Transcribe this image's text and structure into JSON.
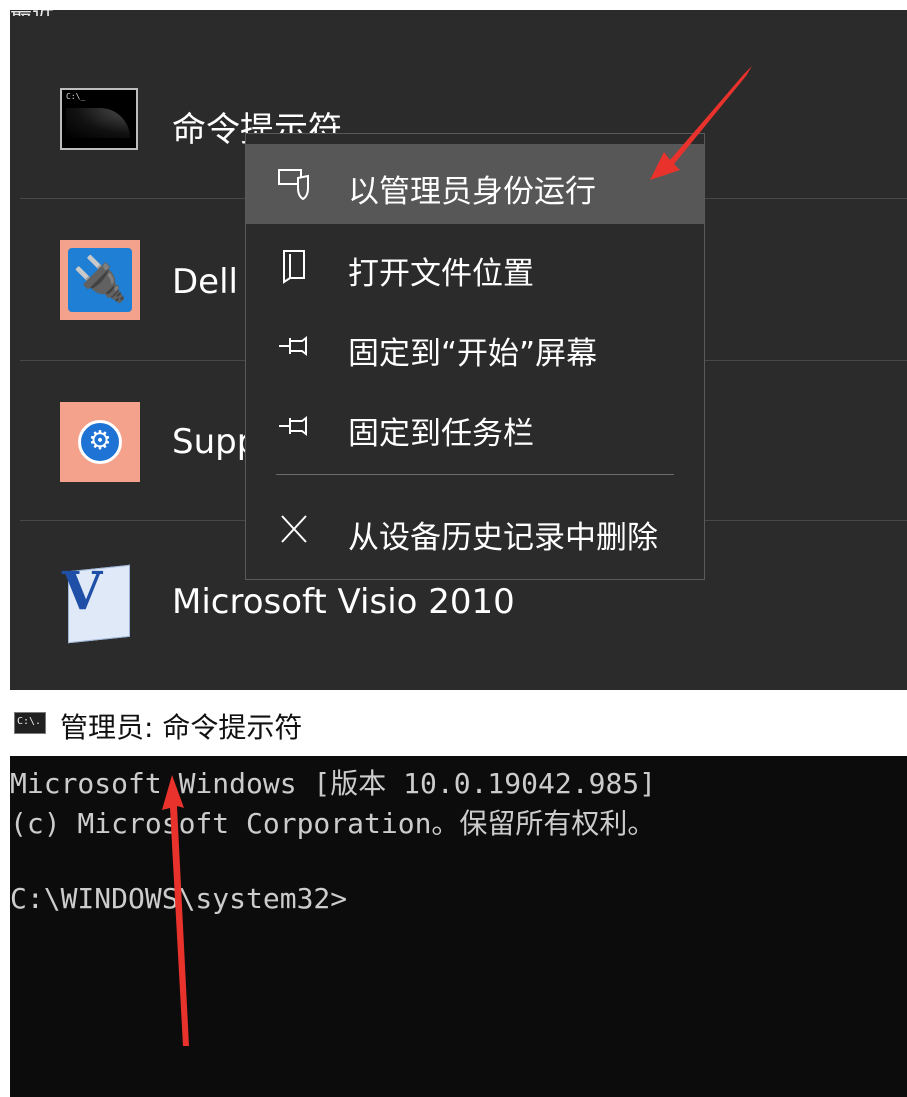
{
  "start_menu": {
    "apps": [
      {
        "label": "命令提示符",
        "icon": "command-prompt-icon"
      },
      {
        "label": "Dell",
        "icon": "dell-power-plug-icon"
      },
      {
        "label": "Supp",
        "icon": "support-wrench-icon"
      },
      {
        "label": "Microsoft Visio 2010",
        "icon": "visio-icon"
      }
    ],
    "top_fragment": "最近"
  },
  "context_menu": {
    "items": [
      {
        "label": "以管理员身份运行",
        "icon": "run-as-admin-shield-icon",
        "highlighted": true
      },
      {
        "label": "打开文件位置",
        "icon": "open-file-location-icon",
        "highlighted": false
      },
      {
        "label": "固定到“开始”屏幕",
        "icon": "pin-icon",
        "highlighted": false
      },
      {
        "label": "固定到任务栏",
        "icon": "pin-icon",
        "highlighted": false
      },
      {
        "label": "从设备历史记录中删除",
        "icon": "close-x-icon",
        "highlighted": false
      }
    ]
  },
  "console": {
    "title": "管理员: 命令提示符",
    "icon_text": "C:\\.",
    "lines": [
      "Microsoft Windows [版本 10.0.19042.985]",
      "(c) Microsoft Corporation。保留所有权利。",
      "",
      "C:\\WINDOWS\\system32>"
    ]
  },
  "colors": {
    "menu_bg": "#2b2b2b",
    "menu_highlight": "#575757",
    "console_bg": "#0c0c0c",
    "console_text": "#cccccc",
    "arrow": "#e8322b"
  }
}
